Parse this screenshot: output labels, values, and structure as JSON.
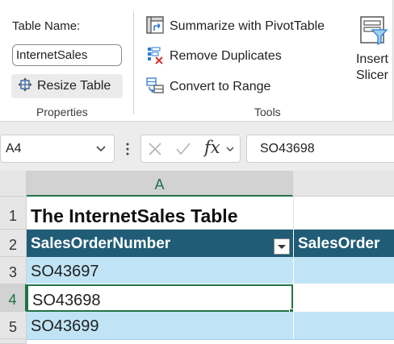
{
  "properties": {
    "table_name_label": "Table Name:",
    "table_name_value": "InternetSales",
    "resize_label": "Resize Table",
    "group_label": "Properties"
  },
  "tools": {
    "summarize_label": "Summarize with PivotTable",
    "remove_duplicates_label": "Remove Duplicates",
    "convert_label": "Convert to Range",
    "group_label": "Tools"
  },
  "slicer": {
    "line1": "Insert",
    "line2": "Slicer"
  },
  "formula_bar": {
    "name_box": "A4",
    "fx": "fx",
    "formula": "SO43698"
  },
  "sheet": {
    "columns": [
      "A"
    ],
    "row_numbers": [
      "1",
      "2",
      "3",
      "4",
      "5"
    ],
    "title": "The InternetSales Table",
    "header_col_a": "SalesOrderNumber",
    "header_col_b": "SalesOrder",
    "rows": [
      "SO43697",
      "SO43698",
      "SO43699"
    ]
  },
  "colors": {
    "header_fill": "#215c77",
    "band_fill": "#c0e4f5",
    "selection": "#217346"
  }
}
